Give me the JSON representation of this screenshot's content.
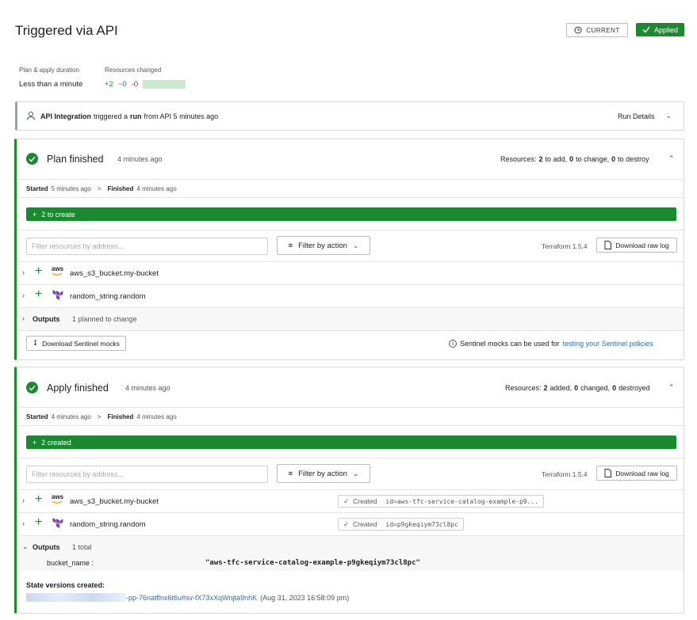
{
  "header": {
    "title": "Triggered via API",
    "current_label": "CURRENT",
    "applied_label": "Applied"
  },
  "summary": {
    "duration_label": "Plan & apply duration",
    "duration_value": "Less than a minute",
    "resources_label": "Resources changed",
    "added": "+2",
    "changed": "~0",
    "destroyed": "-0"
  },
  "trigger": {
    "user": "API Integration",
    "text_mid": "triggered a",
    "run": "run",
    "text_end": "from API 5 minutes ago",
    "details": "Run Details"
  },
  "plan": {
    "title": "Plan finished",
    "time": "4 minutes ago",
    "resources_prefix": "Resources:",
    "add_n": "2",
    "add_t": "to add,",
    "chg_n": "0",
    "chg_t": "to change,",
    "des_n": "0",
    "des_t": "to destroy",
    "started_label": "Started",
    "started_time": "5 minutes ago",
    "sep": ">",
    "finished_label": "Finished",
    "finished_time": "4 minutes ago",
    "bar": "2 to create",
    "filter_placeholder": "Filter resources by address...",
    "filter_action": "Filter by action",
    "tf_version": "Terraform 1.5.4",
    "download_raw": "Download raw log",
    "resources": [
      {
        "name": "aws_s3_bucket.my-bucket",
        "provider": "aws"
      },
      {
        "name": "random_string.random",
        "provider": "terraform"
      }
    ],
    "outputs_label": "Outputs",
    "outputs_note": "1 planned to change",
    "sentinel_button": "Download Sentinel mocks",
    "sentinel_text": "Sentinel mocks can be used for",
    "sentinel_link": "testing your Sentinel policies"
  },
  "apply": {
    "title": "Apply finished",
    "time": "4 minutes ago",
    "resources_prefix": "Resources:",
    "add_n": "2",
    "add_t": "added,",
    "chg_n": "0",
    "chg_t": "changed,",
    "des_n": "0",
    "des_t": "destroyed",
    "started_label": "Started",
    "started_time": "4 minutes ago",
    "sep": ">",
    "finished_label": "Finished",
    "finished_time": "4 minutes ago",
    "bar": "2 created",
    "filter_placeholder": "Filter resources by address...",
    "filter_action": "Filter by action",
    "tf_version": "Terraform 1.5.4",
    "download_raw": "Download raw log",
    "resources": [
      {
        "name": "aws_s3_bucket.my-bucket",
        "provider": "aws",
        "status": "Created",
        "id": "id=aws-tfc-service-catalog-example-p9..."
      },
      {
        "name": "random_string.random",
        "provider": "terraform",
        "status": "Created",
        "id": "id=p9gkeqiym73cl8pc"
      }
    ],
    "outputs_label": "Outputs",
    "outputs_note": "1 total",
    "output_key": "bucket_name :",
    "output_value": "\"aws-tfc-service-catalog-example-p9gkeqiym73cl8pc\"",
    "state_label": "State versions created:",
    "state_link": "-pp-76natflnx6t6u#sv-fX73xXqWnjta9nhK",
    "state_time": "(Aug 31, 2023 16:58:09 pm)"
  },
  "colors": {
    "green": "#1a8a2e",
    "link": "#2b6fb8"
  }
}
